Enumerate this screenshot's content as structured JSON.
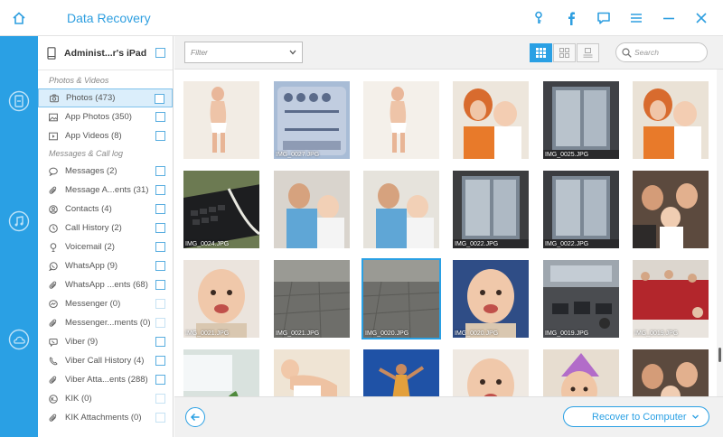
{
  "app": {
    "title": "Data Recovery",
    "titlebar_icons": [
      "key-icon",
      "facebook-icon",
      "feedback-icon",
      "menu-icon",
      "minimize-icon",
      "close-icon"
    ]
  },
  "rail": {
    "items": [
      "device-recovery-icon",
      "itunes-backup-icon",
      "icloud-backup-icon"
    ]
  },
  "sidebar": {
    "device": "Administ...r's iPad",
    "section_photos": "Photos & Videos",
    "photo_items": [
      {
        "label": "Photos (473)",
        "icon": "camera-icon",
        "selected": true
      },
      {
        "label": "App Photos (350)",
        "icon": "image-icon"
      },
      {
        "label": "App Videos (8)",
        "icon": "video-icon"
      }
    ],
    "section_messages": "Messages & Call log",
    "message_items": [
      {
        "label": "Messages (2)",
        "icon": "chat-icon"
      },
      {
        "label": "Message A...ents (31)",
        "icon": "paperclip-icon"
      },
      {
        "label": "Contacts (4)",
        "icon": "contact-icon"
      },
      {
        "label": "Call History (2)",
        "icon": "clock-icon"
      },
      {
        "label": "Voicemail (2)",
        "icon": "voicemail-icon"
      },
      {
        "label": "WhatsApp (9)",
        "icon": "whatsapp-icon"
      },
      {
        "label": "WhatsApp ...ents (68)",
        "icon": "paperclip-icon"
      },
      {
        "label": "Messenger (0)",
        "icon": "messenger-icon",
        "disabled": true
      },
      {
        "label": "Messenger...ments (0)",
        "icon": "paperclip-icon",
        "disabled": true
      },
      {
        "label": "Viber (9)",
        "icon": "viber-icon"
      },
      {
        "label": "Viber Call History (4)",
        "icon": "viber-call-icon"
      },
      {
        "label": "Viber Atta...ents (288)",
        "icon": "paperclip-icon"
      },
      {
        "label": "KIK (0)",
        "icon": "kik-icon",
        "disabled": true
      },
      {
        "label": "KIK Attachments (0)",
        "icon": "paperclip-icon",
        "disabled": true
      }
    ]
  },
  "toolbar": {
    "filter_placeholder": "Filter",
    "search_placeholder": "Search",
    "views": [
      "grid-view-icon",
      "thumbnail-view-icon",
      "list-view-icon"
    ]
  },
  "grid": {
    "photos": [
      {
        "caption": "",
        "bg": "#f2ece4",
        "subject": "baby-standing"
      },
      {
        "caption": "IMG_0027.JPG",
        "bg": "#a8bcd6",
        "subject": "control-center"
      },
      {
        "caption": "",
        "bg": "#f4f0ea",
        "subject": "baby-standing"
      },
      {
        "caption": "",
        "bg": "#ede6dc",
        "subject": "mother-baby"
      },
      {
        "caption": "IMG_0025.JPG",
        "bg": "#3f4146",
        "subject": "window"
      },
      {
        "caption": "",
        "bg": "#eae2d6",
        "subject": "mother-baby"
      },
      {
        "caption": "IMG_0024.JPG",
        "bg": "#6c7a52",
        "subject": "keyboard"
      },
      {
        "caption": "",
        "bg": "#d9d4cd",
        "subject": "father-baby"
      },
      {
        "caption": "",
        "bg": "#e6e3dc",
        "subject": "father-baby"
      },
      {
        "caption": "IMG_0022.JPG",
        "bg": "#3c3d3f",
        "subject": "window"
      },
      {
        "caption": "IMG_0022.JPG",
        "bg": "#3a3c40",
        "subject": "window"
      },
      {
        "caption": "",
        "bg": "#6a5a4e",
        "subject": "family"
      },
      {
        "caption": "IMG_0021.JPG",
        "bg": "#ebe4dd",
        "subject": "baby-face"
      },
      {
        "caption": "IMG_0021.JPG",
        "bg": "#7a7a76",
        "subject": "pavement"
      },
      {
        "caption": "IMG_0020.JPG",
        "bg": "#767773",
        "subject": "pavement",
        "selected": true
      },
      {
        "caption": "IMG_0020.JPG",
        "bg": "#2f4d86",
        "subject": "baby-face"
      },
      {
        "caption": "IMG_0019.JPG",
        "bg": "#5d6064",
        "subject": "office"
      },
      {
        "caption": "IMG_0019.JPG",
        "bg": "#e9e4de",
        "subject": "office-red"
      },
      {
        "caption": "",
        "bg": "#c9d6d2",
        "subject": "screen-plant"
      },
      {
        "caption": "",
        "bg": "#efe6da",
        "subject": "baby-crawl"
      },
      {
        "caption": "",
        "bg": "#1f4fa0",
        "subject": "sky-person"
      },
      {
        "caption": "",
        "bg": "#efe9e2",
        "subject": "baby-face"
      },
      {
        "caption": "",
        "bg": "#e7ddd0",
        "subject": "baby-hat"
      },
      {
        "caption": "",
        "bg": "#d5ccc0",
        "subject": "family"
      }
    ]
  },
  "bottom": {
    "recover_label": "Recover to Computer"
  }
}
